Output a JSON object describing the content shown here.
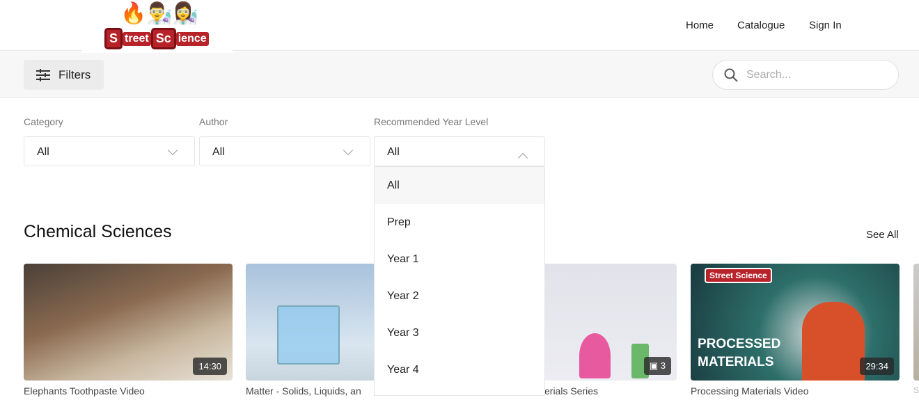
{
  "header": {
    "logo_text": "Street Science",
    "nav": [
      "Home",
      "Catalogue",
      "Sign In"
    ]
  },
  "toolbar": {
    "filters_label": "Filters",
    "search_placeholder": "Search..."
  },
  "filters": [
    {
      "label": "Category",
      "value": "All"
    },
    {
      "label": "Author",
      "value": "All"
    },
    {
      "label": "Recommended Year Level",
      "value": "All",
      "open": true,
      "options": [
        "All",
        "Prep",
        "Year 1",
        "Year 2",
        "Year 3",
        "Year 4"
      ]
    }
  ],
  "section": {
    "title": "Chemical Sciences",
    "see_all": "See All"
  },
  "cards": [
    {
      "title": "Elephants Toothpaste Video",
      "duration": "14:30"
    },
    {
      "title": "Matter - Solids, Liquids, an"
    },
    {
      "title": "erials Series",
      "count": "3"
    },
    {
      "title": "Processing Materials Video",
      "duration": "29:34",
      "overlay": [
        "PROCESSED",
        "MATERIALS"
      ],
      "logo_text": "Street Science"
    },
    {
      "title": "S"
    }
  ]
}
